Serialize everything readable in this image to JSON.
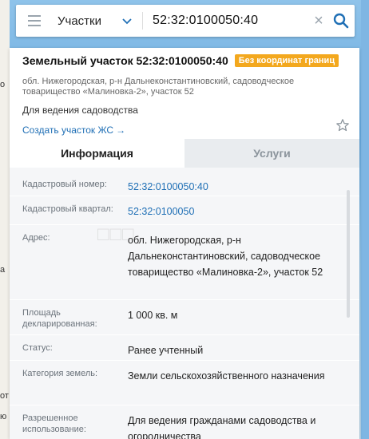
{
  "map_edge_letters": [
    "о",
    "а",
    "от",
    "ю"
  ],
  "search": {
    "select_label": "Участки",
    "query": "52:32:0100050:40",
    "clear_symbol": "×"
  },
  "card": {
    "title": "Земельный участок 52:32:0100050:40",
    "badge": "Без координат границ",
    "address": "обл. Нижегородская, р-н Дальнеконстантиновский, садоводческое товарищество «Малиновка-2», участок 52",
    "purpose": "Для ведения садоводства",
    "create_link": "Создать участок ЖС",
    "create_arrow": "→"
  },
  "tabs": [
    {
      "label": "Информация",
      "active": true
    },
    {
      "label": "Услуги",
      "active": false
    }
  ],
  "details": [
    {
      "key": "Кадастровый номер:",
      "value": "52:32:0100050:40"
    },
    {
      "key": "Кадастровый квартал:",
      "value": "52:32:0100050"
    },
    {
      "key": "Адрес:",
      "value": "обл. Нижегородская, р-н Дальнеконстантиновский, садоводческое товарищество «Малиновка-2», участок 52"
    },
    {
      "key": "Площадь декларированная:",
      "value": "1 000 кв. м"
    },
    {
      "key": "Статус:",
      "value": "Ранее учтенный"
    },
    {
      "key": "Категория земель:",
      "value": "Земли сельскохозяйственного назначения"
    },
    {
      "key": "Разрешенное использование:",
      "value": "Для ведения гражданами садоводства и огородничества"
    }
  ],
  "colors": {
    "badge": "#f3a81e",
    "link": "#1f6fb5",
    "search_icon": "#1f6fb5"
  },
  "icons": [
    "menu-icon",
    "chevron-down-icon",
    "clear-icon",
    "search-icon",
    "star-icon",
    "arrow-right-icon"
  ]
}
